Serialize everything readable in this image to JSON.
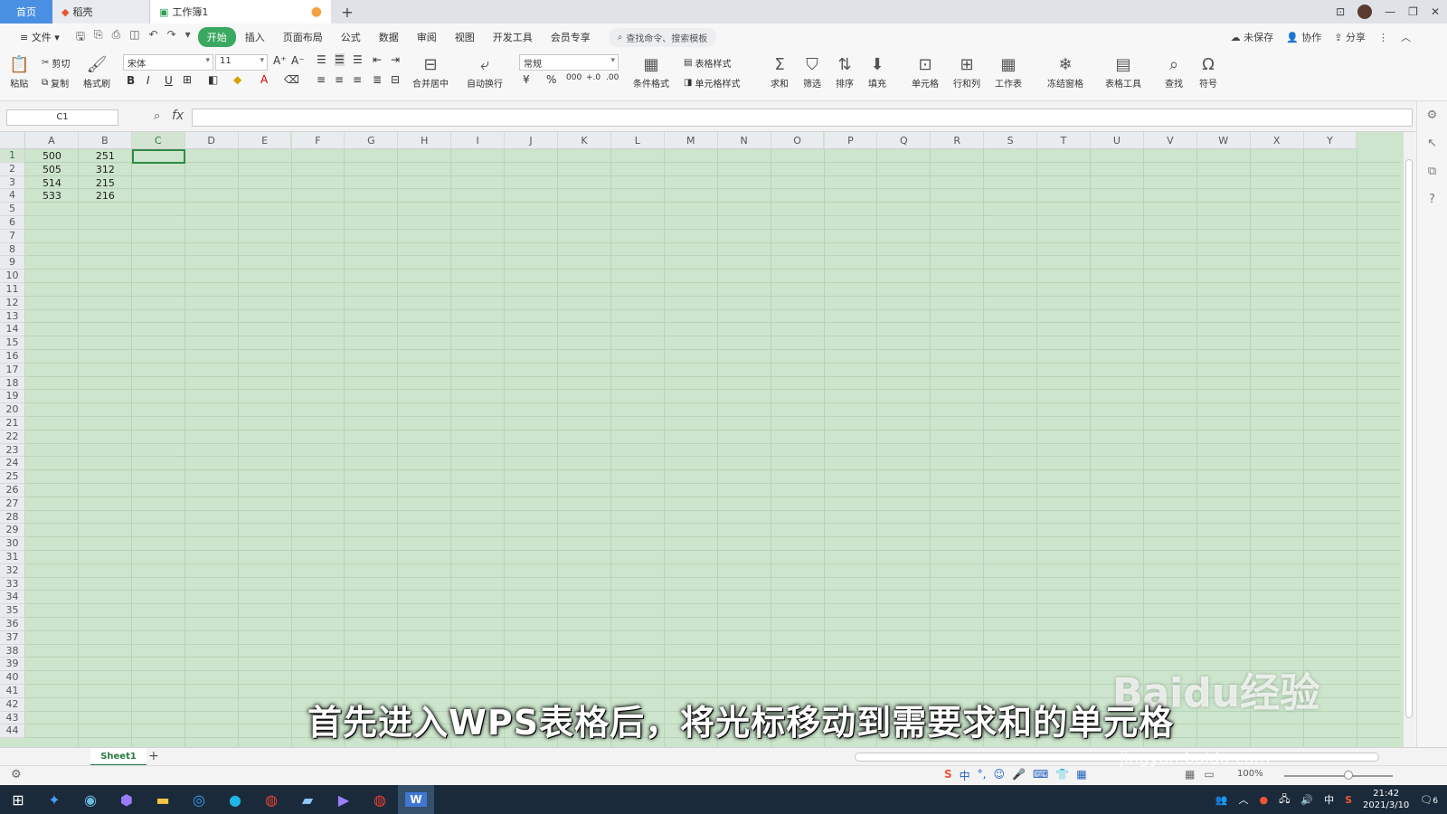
{
  "tabs": {
    "home": "首页",
    "shell": "稻壳",
    "workbook": "工作簿1",
    "new": "+"
  },
  "menu": {
    "file": "文件",
    "items": [
      "开始",
      "插入",
      "页面布局",
      "公式",
      "数据",
      "审阅",
      "视图",
      "开发工具",
      "会员专享"
    ],
    "search": "查找命令、搜索模板",
    "right": {
      "unsaved": "未保存",
      "collab": "协作",
      "share": "分享"
    }
  },
  "ribbon": {
    "paste": "粘贴",
    "cut": "剪切",
    "copy": "复制",
    "format_painter": "格式刷",
    "font": "宋体",
    "font_size": "11",
    "merge": "合并居中",
    "wrap": "自动换行",
    "number_format": "常规",
    "cond_format": "条件格式",
    "table_style": "表格样式",
    "cell_style": "单元格样式",
    "sum": "求和",
    "filter": "筛选",
    "sort": "排序",
    "fill": "填充",
    "cell": "单元格",
    "rowcol": "行和列",
    "worksheet": "工作表",
    "freeze": "冻结窗格",
    "table_tools": "表格工具",
    "find": "查找",
    "symbol": "符号"
  },
  "formula": {
    "name_box": "C1",
    "fx": "fx",
    "value": ""
  },
  "sheet": {
    "columns": [
      "A",
      "B",
      "C",
      "D",
      "E",
      "F",
      "G",
      "H",
      "I",
      "J",
      "K",
      "L",
      "M",
      "N",
      "O",
      "P",
      "Q",
      "R",
      "S",
      "T",
      "U",
      "V",
      "W",
      "X",
      "Y"
    ],
    "rows": 44,
    "selected_cell": "C1",
    "data": [
      [
        "500",
        "251"
      ],
      [
        "505",
        "312"
      ],
      [
        "514",
        "215"
      ],
      [
        "533",
        "216"
      ]
    ]
  },
  "sheet_tabs": {
    "active": "Sheet1",
    "add": "+"
  },
  "status": {
    "zoom": "100%"
  },
  "taskbar": {
    "time": "21:42",
    "date": "2021/3/10",
    "ime": "中",
    "notif": "6"
  },
  "overlay": {
    "subtitle": "首先进入WPS表格后，将光标移动到需要求和的单元格",
    "watermark": "Baidu经验",
    "watermark_url": "jingyan.baidu.com"
  }
}
